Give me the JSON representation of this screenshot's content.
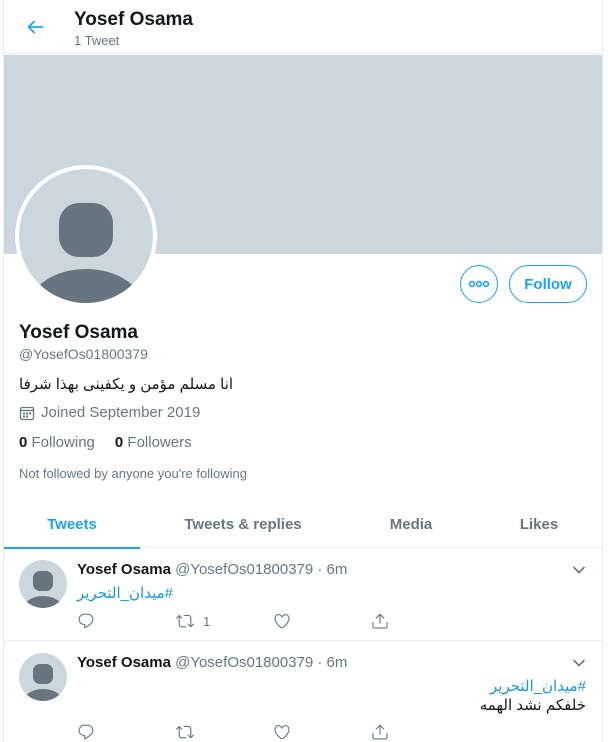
{
  "header": {
    "title": "Yosef Osama",
    "subtitle": "1 Tweet"
  },
  "profile": {
    "name": "Yosef Osama",
    "handle": "@YosefOs01800379",
    "bio": "انا مسلم مؤمن و يكفينى بهذا شرفا",
    "joined": "Joined September 2019",
    "following_count": "0",
    "following_label": "Following",
    "followers_count": "0",
    "followers_label": "Followers",
    "not_followed": "Not followed by anyone you're following",
    "follow_label": "Follow"
  },
  "tabs": [
    {
      "label": "Tweets"
    },
    {
      "label": "Tweets & replies"
    },
    {
      "label": "Media"
    },
    {
      "label": "Likes"
    }
  ],
  "tweets": [
    {
      "name": "Yosef Osama",
      "meta": "@YosefOs01800379 · 6m",
      "hashtag": "#ميدان_التحرير",
      "text": "",
      "retweets": "1"
    },
    {
      "name": "Yosef Osama",
      "meta": "@YosefOs01800379 · 6m",
      "hashtag": "#ميدان_التحرير",
      "text": "خلفكم نشد الهمه",
      "retweets": ""
    }
  ],
  "colors": {
    "accent": "#1da1f2",
    "banner": "#ccd6dd",
    "secondary_text": "#657786"
  },
  "icons": [
    "back-arrow-icon",
    "more-icon",
    "calendar-icon",
    "chevron-down-icon",
    "reply-icon",
    "retweet-icon",
    "like-icon",
    "share-icon",
    "default-avatar-icon"
  ]
}
